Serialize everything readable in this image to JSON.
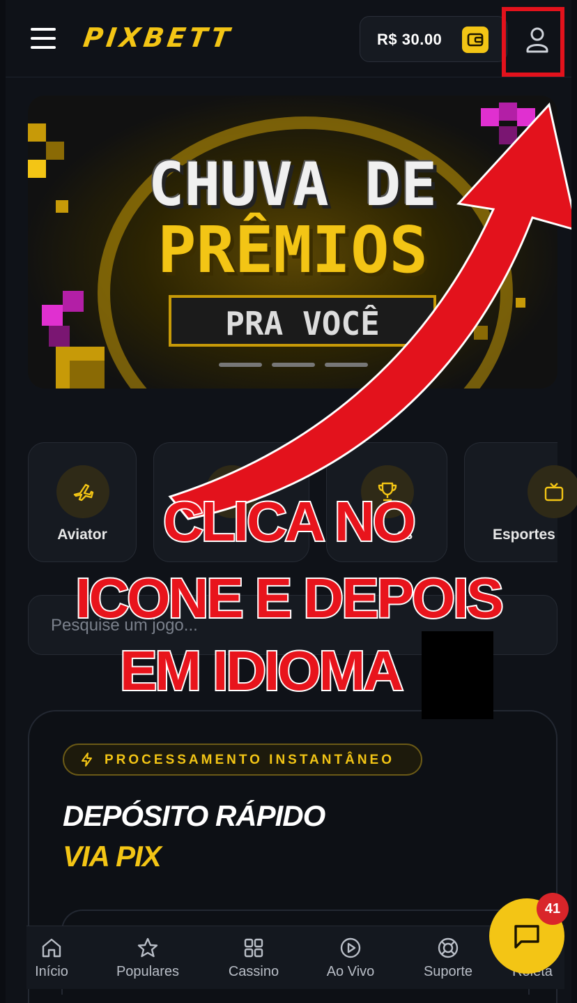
{
  "header": {
    "logo": "PIXBETT",
    "balance": "R$ 30.00",
    "menu_icon": "hamburger-icon",
    "wallet_icon": "wallet-icon",
    "user_icon": "user-icon"
  },
  "banner": {
    "title_line1": "CHUVA DE",
    "title_line2": "PRÊMIOS",
    "subtitle": "PRA VOCÊ"
  },
  "categories": [
    {
      "label": "Aviator",
      "icon": "plane-icon"
    },
    {
      "label": "",
      "icon": "thumbs-up-icon"
    },
    {
      "label": "es",
      "icon": "trophy-icon"
    },
    {
      "label": "Esportes",
      "icon": "tv-icon"
    }
  ],
  "search": {
    "placeholder": "Pesquise um jogo..."
  },
  "promo": {
    "badge": "PROCESSAMENTO INSTANTÂNEO",
    "title": "DEPÓSITO RÁPIDO",
    "subtitle": "VIA PIX"
  },
  "bottom_nav": [
    {
      "label": "Início",
      "icon": "home-icon"
    },
    {
      "label": "Populares",
      "icon": "star-icon"
    },
    {
      "label": "Cassino",
      "icon": "grid-icon"
    },
    {
      "label": "Ao Vivo",
      "icon": "play-icon"
    },
    {
      "label": "Suporte",
      "icon": "lifebuoy-icon"
    },
    {
      "label": "Roleta",
      "icon": "roulette-icon"
    }
  ],
  "chat": {
    "badge_count": "41",
    "icon": "chat-icon"
  },
  "annotation": {
    "line1": "CLICA NO",
    "line2": "ICONE E DEPOIS",
    "line3": "EM IDIOMA",
    "color": "#e3121c"
  },
  "colors": {
    "accent": "#f3c515",
    "background": "#0f1218",
    "annotation_red": "#e3121c"
  }
}
